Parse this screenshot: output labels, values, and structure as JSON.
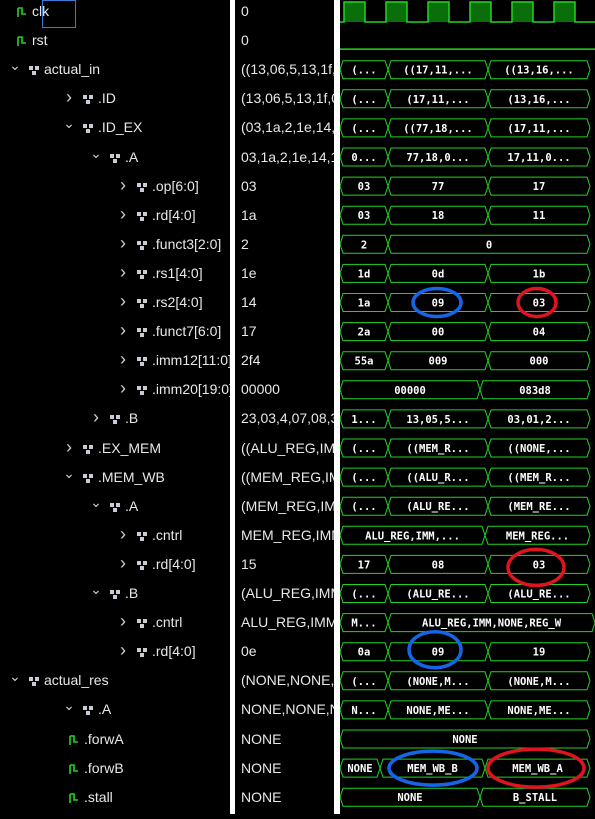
{
  "signals": [
    {
      "name": "clk",
      "chev": "",
      "icon": "signal-icon",
      "value": "0"
    },
    {
      "name": "rst",
      "chev": "",
      "icon": "signal-icon",
      "value": "0"
    },
    {
      "name": "actual_in",
      "chev": "v",
      "icon": "struct-icon",
      "value": "((13,06,5,13,1f,"
    },
    {
      "name": ".ID",
      "chev": ">",
      "icon": "struct-icon",
      "value": "(13,06,5,13,1f,0"
    },
    {
      "name": ".ID_EX",
      "chev": "v",
      "icon": "struct-icon",
      "value": "(03,1a,2,1e,14,"
    },
    {
      "name": ".A",
      "chev": "v",
      "icon": "struct-icon",
      "value": "03,1a,2,1e,14,1"
    },
    {
      "name": ".op[6:0]",
      "chev": ">",
      "icon": "struct-icon",
      "value": "03"
    },
    {
      "name": ".rd[4:0]",
      "chev": ">",
      "icon": "struct-icon",
      "value": "1a"
    },
    {
      "name": ".funct3[2:0]",
      "chev": ">",
      "icon": "struct-icon",
      "value": "2"
    },
    {
      "name": ".rs1[4:0]",
      "chev": ">",
      "icon": "struct-icon",
      "value": "1e"
    },
    {
      "name": ".rs2[4:0]",
      "chev": ">",
      "icon": "struct-icon",
      "value": "14"
    },
    {
      "name": ".funct7[6:0]",
      "chev": ">",
      "icon": "struct-icon",
      "value": "17"
    },
    {
      "name": ".imm12[11:0]",
      "chev": ">",
      "icon": "struct-icon",
      "value": "2f4"
    },
    {
      "name": ".imm20[19:0]",
      "chev": ">",
      "icon": "struct-icon",
      "value": "00000"
    },
    {
      "name": ".B",
      "chev": ">",
      "icon": "struct-icon",
      "value": "23,03,4,07,08,3"
    },
    {
      "name": ".EX_MEM",
      "chev": ">",
      "icon": "struct-icon",
      "value": "((ALU_REG,IMM"
    },
    {
      "name": ".MEM_WB",
      "chev": "v",
      "icon": "struct-icon",
      "value": "((MEM_REG,IM"
    },
    {
      "name": ".A",
      "chev": "v",
      "icon": "struct-icon",
      "value": "(MEM_REG,IMM"
    },
    {
      "name": ".cntrl",
      "chev": ">",
      "icon": "struct-icon",
      "value": "MEM_REG,IMM"
    },
    {
      "name": ".rd[4:0]",
      "chev": ">",
      "icon": "struct-icon",
      "value": "15"
    },
    {
      "name": ".B",
      "chev": "v",
      "icon": "struct-icon",
      "value": "(ALU_REG,IMM"
    },
    {
      "name": ".cntrl",
      "chev": ">",
      "icon": "struct-icon",
      "value": "ALU_REG,IMM"
    },
    {
      "name": ".rd[4:0]",
      "chev": ">",
      "icon": "struct-icon",
      "value": "0e"
    },
    {
      "name": "actual_res",
      "chev": "v",
      "icon": "struct-icon",
      "value": "(NONE,NONE,"
    },
    {
      "name": ".A",
      "chev": "v",
      "icon": "struct-icon",
      "value": "NONE,NONE,N"
    },
    {
      "name": ".forwA",
      "chev": "",
      "icon": "signal-icon",
      "value": "NONE"
    },
    {
      "name": ".forwB",
      "chev": "",
      "icon": "signal-icon",
      "value": "NONE"
    },
    {
      "name": ".stall",
      "chev": "",
      "icon": "signal-icon",
      "value": "NONE"
    }
  ],
  "waves": [
    null,
    null,
    [
      "(...",
      "((17,11,...",
      "((13,16,..."
    ],
    [
      "(...",
      "(17,11,...",
      "(13,16,..."
    ],
    [
      "(...",
      "((77,18,...",
      "(17,11,..."
    ],
    [
      "0...",
      "77,18,0...",
      "17,11,0..."
    ],
    [
      "03",
      "77",
      "17"
    ],
    [
      "03",
      "18",
      "11"
    ],
    [
      "2",
      "0"
    ],
    [
      "1d",
      "0d",
      "1b"
    ],
    [
      "1a",
      "09",
      "03"
    ],
    [
      "2a",
      "00",
      "04"
    ],
    [
      "55a",
      "009",
      "000"
    ],
    [
      "00000",
      "083d8"
    ],
    [
      "1...",
      "13,05,5...",
      "03,01,2..."
    ],
    [
      "(...",
      "((MEM_R...",
      "((NONE,..."
    ],
    [
      "(...",
      "((ALU_R...",
      "((MEM_R..."
    ],
    [
      "(...",
      "(ALU_RE...",
      "(MEM_RE..."
    ],
    [
      "ALU_REG,IMM,...",
      "MEM_REG..."
    ],
    [
      "17",
      "08",
      "03"
    ],
    [
      "(...",
      "(ALU_RE...",
      "(ALU_RE..."
    ],
    [
      "M...",
      "ALU_REG,IMM,NONE,REG_W"
    ],
    [
      "0a",
      "09",
      "19"
    ],
    [
      "(...",
      "(NONE,M...",
      "(NONE,M..."
    ],
    [
      "N...",
      "NONE,ME...",
      "NONE,ME..."
    ],
    [
      "NONE"
    ],
    [
      "NONE",
      "MEM_WB_B",
      "MEM_WB_A"
    ],
    [
      "NONE",
      "B_STALL"
    ]
  ],
  "colors": {
    "wave_green": "#22d422",
    "clock_fill": "#0a6e0a",
    "annotation_blue": "#1565e8",
    "annotation_red": "#e0141e",
    "icon_gray": "#c8ccd4",
    "selection_border": "#3a7bd5"
  }
}
